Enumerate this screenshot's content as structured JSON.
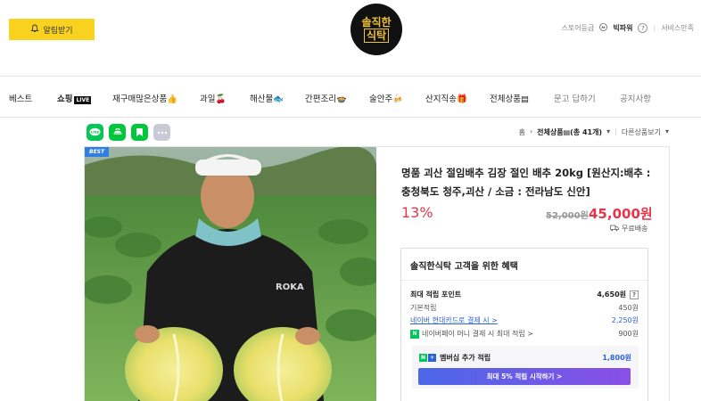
{
  "header": {
    "alarm_label": "알림받기",
    "logo_line1": "솔직한",
    "logo_line2": "식탁",
    "store_grade_label": "스토어등급",
    "store_grade_value": "빅파워",
    "help_icon": "?",
    "service_link": "서비스만족"
  },
  "nav": {
    "items": [
      {
        "label": "베스트"
      },
      {
        "label": "쇼핑",
        "badge": "LIVE"
      },
      {
        "label": "재구매많은상품👍"
      },
      {
        "label": "과일🍒"
      },
      {
        "label": "해산물🐟"
      },
      {
        "label": "간편조리🍲"
      },
      {
        "label": "술안주🍻"
      },
      {
        "label": "산지직송🎁"
      },
      {
        "label": "전체상품▤"
      },
      {
        "label": "문고 답하기"
      },
      {
        "label": "공지사항"
      }
    ]
  },
  "share": {
    "icons": [
      "line-icon",
      "band-icon",
      "bookmark-icon",
      "more-icon"
    ],
    "colors": [
      "#06c755",
      "#00c73c",
      "#00c73c",
      "#c8cbd6"
    ]
  },
  "breadcrumb": {
    "home": "홈",
    "category": "전체상품▤(총 41개)",
    "next": "다른상품보기"
  },
  "product": {
    "badge": "BEST",
    "title": "명품 괴산 절임배추 김장 절인 배추 20kg [원산지:배추 : 충청북도 청주,괴산 / 소금 : 전라남도 신안]",
    "discount": "13%",
    "original_price": "52,000원",
    "price": "45,000원",
    "shipping": "무료배송"
  },
  "benefit": {
    "title": "솔직한식탁 고객을 위한 혜택",
    "max_points_label": "최대 적립 포인트",
    "max_points_value": "4,650원",
    "help": "?",
    "base_label": "기본적립",
    "base_value": "450원",
    "card_label": "네이버 현대카드로 결제 시 >",
    "card_value": "2,250원",
    "npay_label": "네이버페이 머니 결제 시 최대 적립 >",
    "npay_value": "900원",
    "npay_badge": "N",
    "membership_label": "멤버십 추가 적립",
    "membership_value": "1,800원",
    "membership_badge1": "N",
    "membership_badge2": "+",
    "membership_button": "최대 5% 적립 시작하기 >"
  },
  "photo_text": "ROKA",
  "colors": {
    "accent_yellow": "#f9d21f",
    "price_red": "#e5364b",
    "link_blue": "#2b63d8",
    "naver_green": "#03c75a"
  }
}
